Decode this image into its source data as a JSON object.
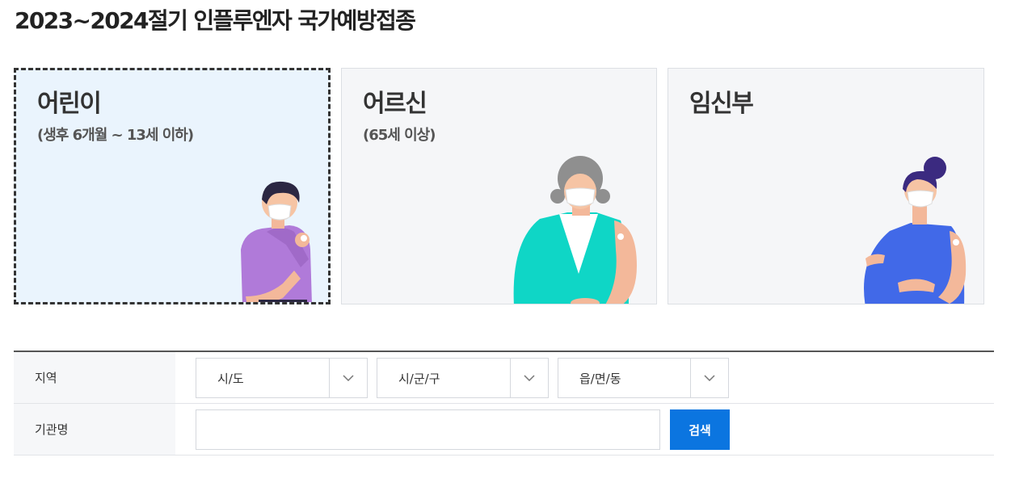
{
  "page": {
    "title": "2023~2024절기 인플루엔자 국가예방접종"
  },
  "targets": [
    {
      "title": "어린이",
      "subtitle": "(생후 6개월 ~ 13세 이하)",
      "selected": true
    },
    {
      "title": "어르신",
      "subtitle": "(65세 이상)",
      "selected": false
    },
    {
      "title": "임신부",
      "subtitle": "",
      "selected": false
    }
  ],
  "search": {
    "region_label": "지역",
    "sido": "시/도",
    "sigungu": "시/군/구",
    "eupmyeondong": "읍/면/동",
    "org_label": "기관명",
    "org_value": "",
    "button_label": "검색"
  },
  "colors": {
    "accent": "#0b75e0",
    "selected_bg": "#eaf4fd",
    "card_bg": "#f5f6f8",
    "child_shirt": "#b07ad9",
    "elder_shirt": "#0fd6c6",
    "pregnant_dress": "#4169e8"
  }
}
